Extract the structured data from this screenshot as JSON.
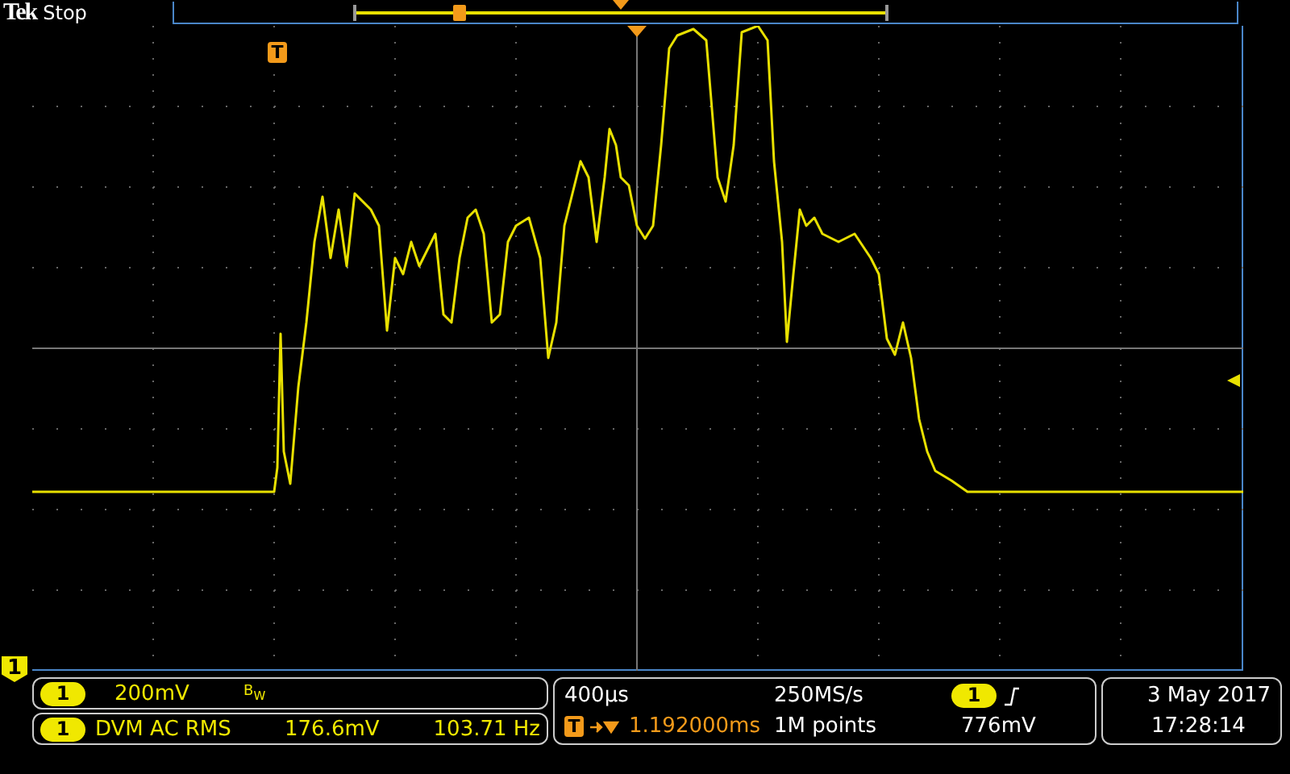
{
  "header": {
    "brand": "Tek",
    "status": "Stop"
  },
  "markers": {
    "trigger_position": "T",
    "channel": "1"
  },
  "channel_panel": {
    "channel": "1",
    "scale": "200mV",
    "bandwidth": "B$_{W}$"
  },
  "measurement": {
    "channel": "1",
    "label": "DVM AC RMS",
    "value": "176.6mV",
    "frequency": "103.71 Hz"
  },
  "timebase": {
    "scale": "400µs",
    "sample_rate": "250MS/s",
    "trigger_symbol": "T",
    "delay": "1.192000ms",
    "record_length": "1M points"
  },
  "trigger": {
    "channel": "1",
    "level": "776mV"
  },
  "clock": {
    "date": "3 May 2017",
    "time": "17:28:14"
  }
}
